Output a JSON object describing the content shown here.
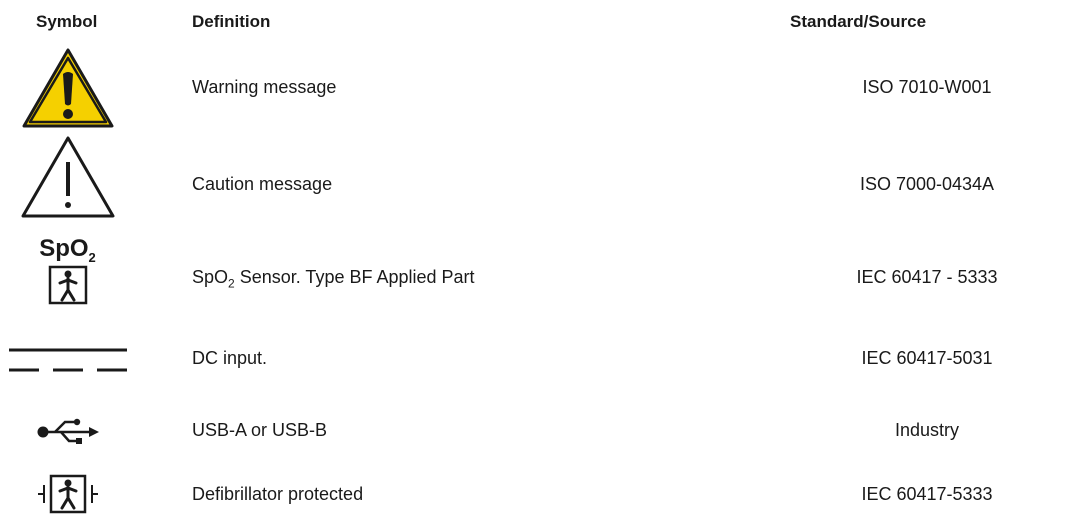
{
  "headers": {
    "symbol": "Symbol",
    "definition": "Definition",
    "source": "Standard/Source"
  },
  "rows": [
    {
      "icon": "warning-triangle-yellow-icon",
      "definition": "Warning message",
      "source": "ISO 7010-W001"
    },
    {
      "icon": "caution-triangle-outline-icon",
      "definition": "Caution message",
      "source": "ISO 7000-0434A"
    },
    {
      "icon": "spo2-sensor-type-bf-icon",
      "icon_text_main": "SpO",
      "icon_text_sub": "2",
      "definition_main": "SpO",
      "definition_sub": "2",
      "definition_rest": " Sensor. Type BF Applied Part",
      "source": "IEC 60417 - 5333"
    },
    {
      "icon": "dc-input-icon",
      "definition": "DC input.",
      "source": "IEC 60417-5031"
    },
    {
      "icon": "usb-icon",
      "definition": "USB-A or USB-B",
      "source": "Industry"
    },
    {
      "icon": "defibrillator-protected-icon",
      "definition": "Defibrillator protected",
      "source": "IEC 60417-5333"
    }
  ],
  "colors": {
    "warning_yellow": "#f5d000",
    "text": "#1a1a1a"
  }
}
